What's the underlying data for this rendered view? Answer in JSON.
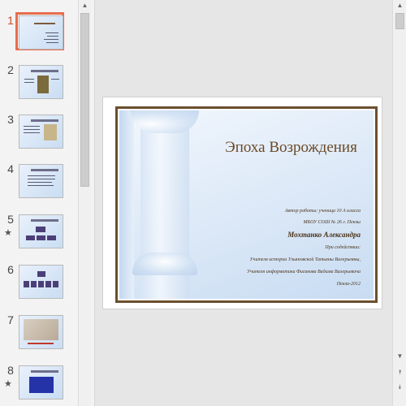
{
  "thumbnails": [
    {
      "number": "1",
      "starred": false,
      "active": true
    },
    {
      "number": "2",
      "starred": false,
      "active": false
    },
    {
      "number": "3",
      "starred": false,
      "active": false
    },
    {
      "number": "4",
      "starred": false,
      "active": false
    },
    {
      "number": "5",
      "starred": true,
      "active": false
    },
    {
      "number": "6",
      "starred": false,
      "active": false
    },
    {
      "number": "7",
      "starred": false,
      "active": false
    },
    {
      "number": "8",
      "starred": true,
      "active": false
    }
  ],
  "star_glyph": "★",
  "slide": {
    "title": "Эпоха Возрождения",
    "credits": [
      "Автор работы: ученица 10 А класса",
      "МБОУ СОШ № 26 г. Пензы",
      "Мохтанко Александра",
      "При содействии:",
      "Учителя истории Ульяновской Татьяны Валерьевны,",
      "Учителя информатики Фисакова Вадима Валерьевича",
      "Пенза-2012"
    ]
  },
  "scroll": {
    "up": "▲",
    "down": "▼",
    "page_up": "⯭",
    "page_down": "⯯"
  },
  "colors": {
    "active_accent": "#e86c4e",
    "slide_border": "#6b4f2f",
    "title_color": "#6b4a28"
  }
}
